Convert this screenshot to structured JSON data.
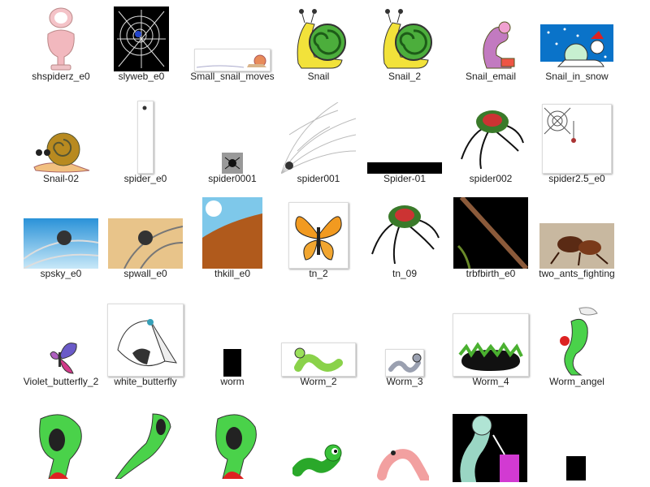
{
  "files": [
    {
      "label": "shspiderz_e0"
    },
    {
      "label": "slyweb_e0"
    },
    {
      "label": "Small_snail_moves"
    },
    {
      "label": "Snail"
    },
    {
      "label": "Snail_2"
    },
    {
      "label": "Snail_email"
    },
    {
      "label": "Snail_in_snow"
    },
    {
      "label": "Snail-02"
    },
    {
      "label": "spider_e0"
    },
    {
      "label": "spider0001"
    },
    {
      "label": "spider001"
    },
    {
      "label": "Spider-01"
    },
    {
      "label": "spider002"
    },
    {
      "label": "spider2.5_e0"
    },
    {
      "label": "spsky_e0"
    },
    {
      "label": "spwall_e0"
    },
    {
      "label": "thkill_e0"
    },
    {
      "label": "tn_2"
    },
    {
      "label": "tn_09"
    },
    {
      "label": "trbfbirth_e0"
    },
    {
      "label": "two_ants_fighting"
    },
    {
      "label": "Violet_butterfly_2"
    },
    {
      "label": "white_butterfly"
    },
    {
      "label": "worm"
    },
    {
      "label": "Worm_2"
    },
    {
      "label": "Worm_3"
    },
    {
      "label": "Worm_4"
    },
    {
      "label": "Worm_angel"
    }
  ]
}
